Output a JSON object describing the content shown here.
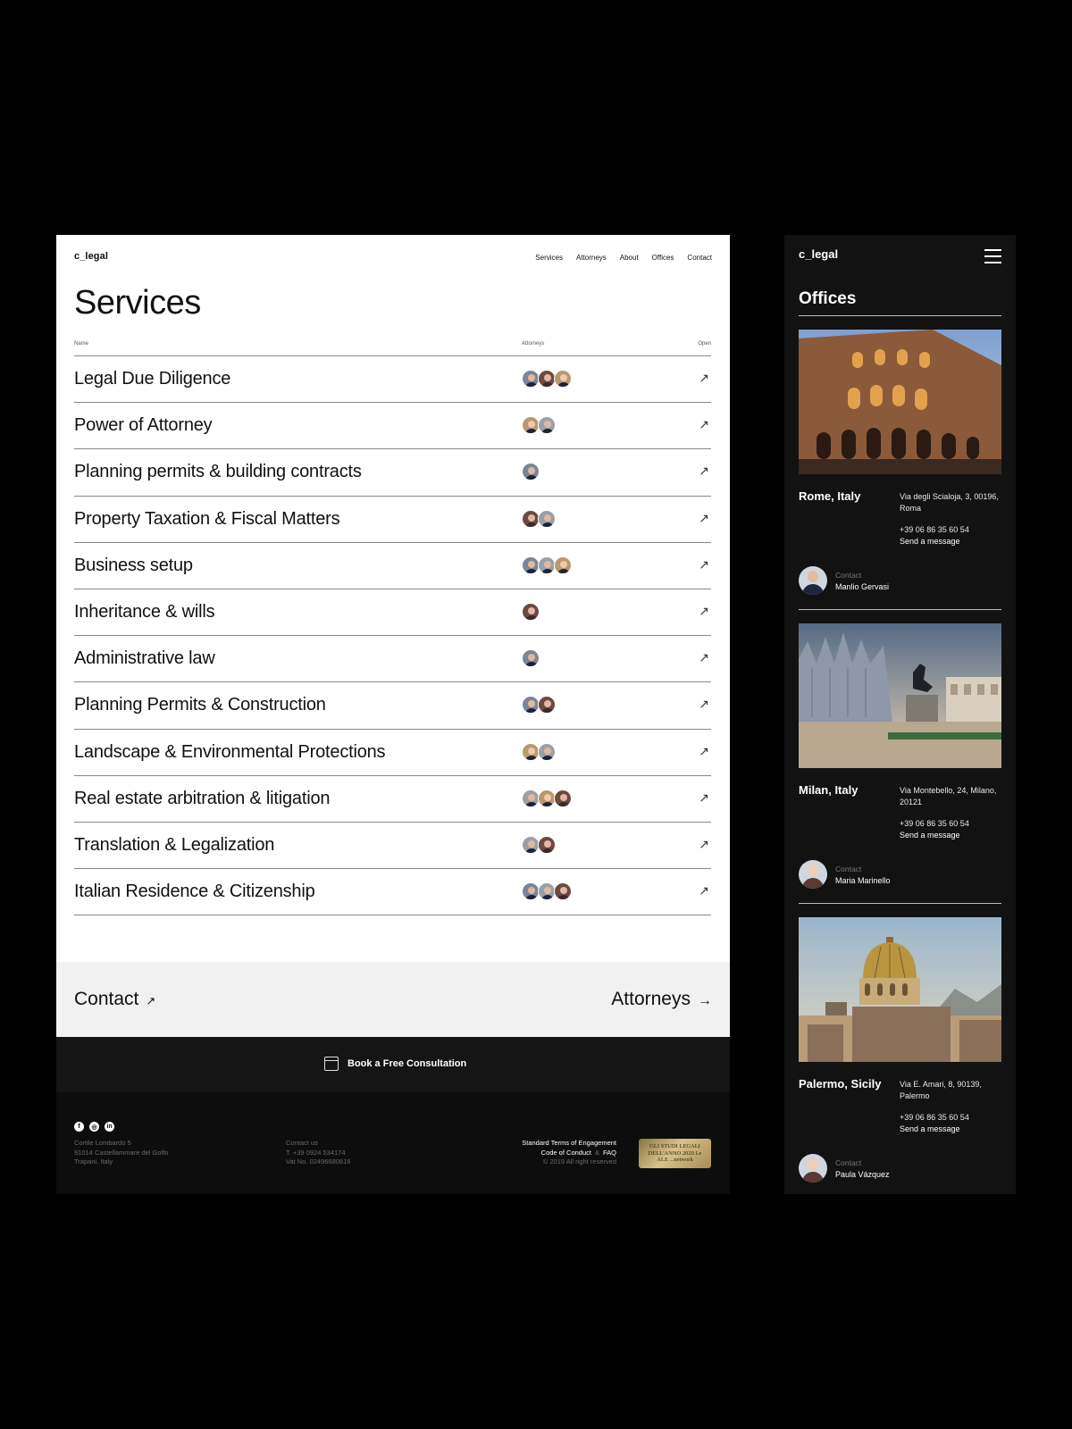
{
  "desktop": {
    "logo": "c_legal",
    "nav": [
      "Services",
      "Attorneys",
      "About",
      "Offices",
      "Contact"
    ],
    "title": "Services",
    "table_head": {
      "name": "Name",
      "attorneys": "Attorneys",
      "open": "Open"
    },
    "open_icon": "arrow-up-right-icon",
    "rows": [
      {
        "title": "Legal Due Diligence",
        "attorneys": [
          "dark",
          "brown",
          "blonde"
        ]
      },
      {
        "title": "Power of Attorney",
        "attorneys": [
          "blonde",
          "gray"
        ]
      },
      {
        "title": "Planning permits & building contracts",
        "attorneys": [
          "dark"
        ]
      },
      {
        "title": "Property Taxation & Fiscal Matters",
        "attorneys": [
          "brown",
          "gray"
        ]
      },
      {
        "title": "Business setup",
        "attorneys": [
          "dark",
          "gray",
          "blonde"
        ]
      },
      {
        "title": "Inheritance & wills",
        "attorneys": [
          "brown"
        ]
      },
      {
        "title": "Administrative law",
        "attorneys": [
          "dark"
        ]
      },
      {
        "title": "Planning Permits & Construction",
        "attorneys": [
          "dark",
          "brown"
        ]
      },
      {
        "title": "Landscape & Environmental Protections",
        "attorneys": [
          "blonde",
          "gray"
        ]
      },
      {
        "title": "Real estate arbitration & litigation",
        "attorneys": [
          "gray",
          "blonde",
          "brown"
        ]
      },
      {
        "title": "Translation & Legalization",
        "attorneys": [
          "gray",
          "brown"
        ]
      },
      {
        "title": "Italian Residence & Citizenship",
        "attorneys": [
          "dark",
          "gray",
          "brown"
        ]
      }
    ],
    "links": {
      "contact": "Contact",
      "contact_arrow": "↗",
      "attorneys": "Attorneys",
      "attorneys_arrow": "→"
    },
    "cta": "Book a Free Consultation",
    "footer": {
      "social": [
        "f",
        "◎",
        "in"
      ],
      "address": [
        "Cortile Lombardo 5",
        "91014 Castellammare del Golfo",
        "Trapani, Italy"
      ],
      "contact": [
        "Contact us",
        "T. +39 0924 534174",
        "Vat No. 02496680816"
      ],
      "terms": "Standard Terms of Engagement",
      "conduct": "Code of Conduct",
      "amp": "&",
      "faq": "FAQ",
      "copyright": "© 2019 All right reserved",
      "badge": "GLI STUDI LEGALI DELL'ANNO 2020 Le ALE ...network"
    }
  },
  "mobile": {
    "logo": "c_legal",
    "title": "Offices",
    "contact_label": "Contact",
    "offices": [
      {
        "city": "Rome, Italy",
        "address": "Via degli Scialoja, 3, 00196, Roma",
        "phone": "+39 06 86 35 60 54",
        "message": "Send a message",
        "contact": "Manlio Gervasi"
      },
      {
        "city": "Milan, Italy",
        "address": "Via Montebello, 24, Milano, 20121",
        "phone": "+39 06 86 35 60 54",
        "message": "Send a message",
        "contact": "Maria Marinello"
      },
      {
        "city": "Palermo, Sicily",
        "address": "Via E. Amari, 8, 90139, Palermo",
        "phone": "+39 06 86 35 60 54",
        "message": "Send a message",
        "contact": "Paula Vázquez"
      }
    ]
  }
}
